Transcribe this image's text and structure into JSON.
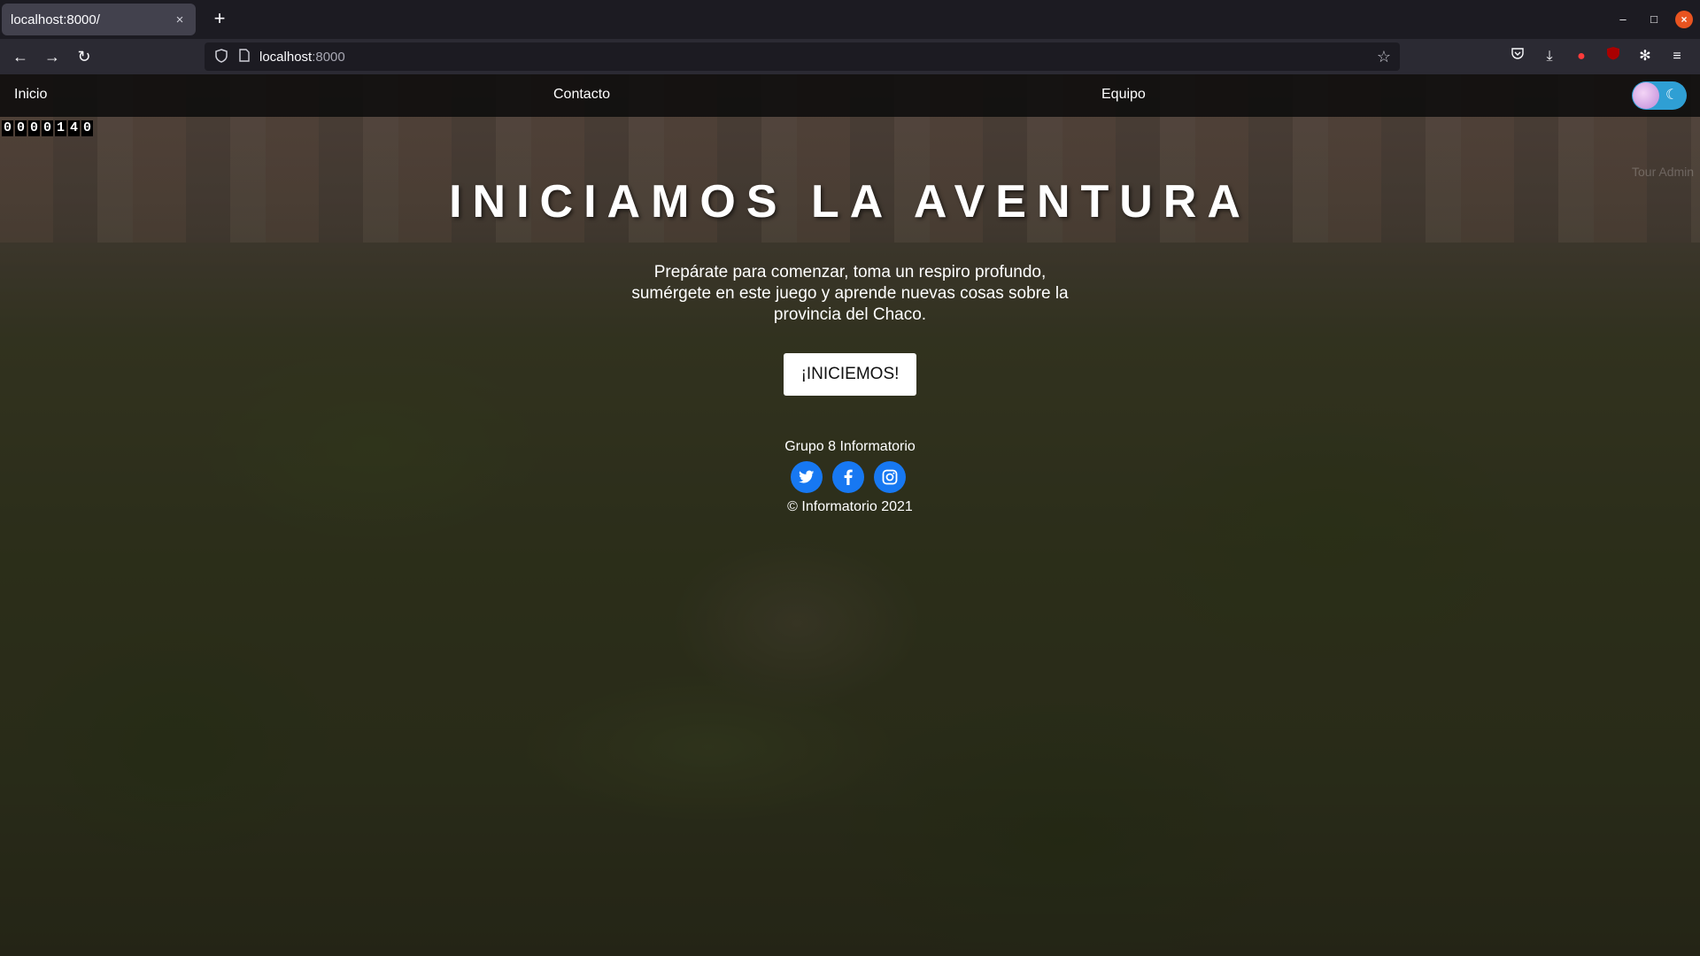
{
  "browser": {
    "tab_title": "localhost:8000/",
    "tab_close": "×",
    "new_tab": "+",
    "url_host": "localhost",
    "url_port": ":8000",
    "window_controls": {
      "minimize": "–",
      "maximize": "□",
      "close": "×"
    }
  },
  "site_nav": {
    "items": [
      "Inicio",
      "Contacto",
      "Equipo"
    ]
  },
  "counter": {
    "digits": [
      "0",
      "0",
      "0",
      "0",
      "1",
      "4",
      "0"
    ]
  },
  "corner_text": "Tour Admin",
  "hero": {
    "title": "INICIAMOS LA AVENTURA",
    "subtitle": "Prepárate para comenzar, toma un respiro profundo, sumérgete en este juego y aprende nuevas cosas sobre la provincia del Chaco.",
    "cta_label": "¡INICIEMOS!"
  },
  "footer": {
    "group": "Grupo 8 Informatorio",
    "social": [
      "twitter-icon",
      "facebook-icon",
      "instagram-icon"
    ],
    "copyright": "© Informatorio 2021"
  },
  "colors": {
    "social_blue": "#1778f2",
    "toggle_blue": "#2f9fd4",
    "nav_bg": "#0a0a0a"
  }
}
